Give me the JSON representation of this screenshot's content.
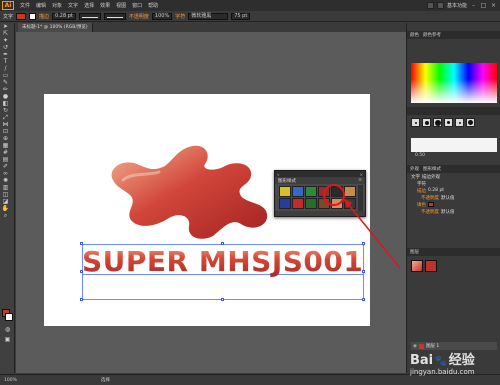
{
  "app": {
    "logo": "Ai"
  },
  "menu": [
    "文件",
    "编辑",
    "对象",
    "文字",
    "选择",
    "效果",
    "视图",
    "窗口",
    "帮助"
  ],
  "essentials_label": "基本功能",
  "control": {
    "selection_label": "文字",
    "stroke_label": "描边",
    "stroke_value": "0.28 pt",
    "opacity_label": "不透明度",
    "opacity_value": "100%",
    "char_label": "字符",
    "font_value": "微软雅黑",
    "size_value": "75 pt"
  },
  "doc_tab": "未标题-1* @ 100% (RGB/预览)",
  "graphic_styles_panel": {
    "title": "图形样式",
    "swatches": [
      "#d9c12a",
      "#3a66c9",
      "#2d8a3a",
      "#9d2a2a",
      "#2a2a2a",
      "#c98b4a",
      "#2a3a9e",
      "#c42a2a",
      "#2a6d2a",
      "#7a4a2a",
      "#d98a5a",
      "#3a3a3a"
    ]
  },
  "headline": {
    "text": "SUPER MHSJS001"
  },
  "right_panel": {
    "color_tab": "颜色",
    "color_guide_tab": "颜色参考",
    "stroke_value": "0.50",
    "appearance_title": "外观",
    "appearance_tab2": "图形样式",
    "appearance_rows": [
      {
        "label": "文字",
        "value": "描边外观"
      },
      {
        "label": "字符",
        "value": ""
      },
      {
        "label": "描边",
        "value": "0.28 pt"
      },
      {
        "label": "不透明度",
        "value": "默认值"
      },
      {
        "label": "填色",
        "value": ""
      },
      {
        "label": "不透明度",
        "value": "默认值"
      }
    ],
    "layers_title": "图层",
    "layer_name": "图层 1"
  },
  "status": {
    "zoom": "100%",
    "mode": "选择"
  },
  "watermark": {
    "brand": "Bai",
    "brand2": "经验",
    "url": "jingyan.baidu.com"
  },
  "colors": {
    "accent": "#e0161d",
    "text_gradient_top": "#f0a07a",
    "text_gradient_bottom": "#a52a25"
  }
}
